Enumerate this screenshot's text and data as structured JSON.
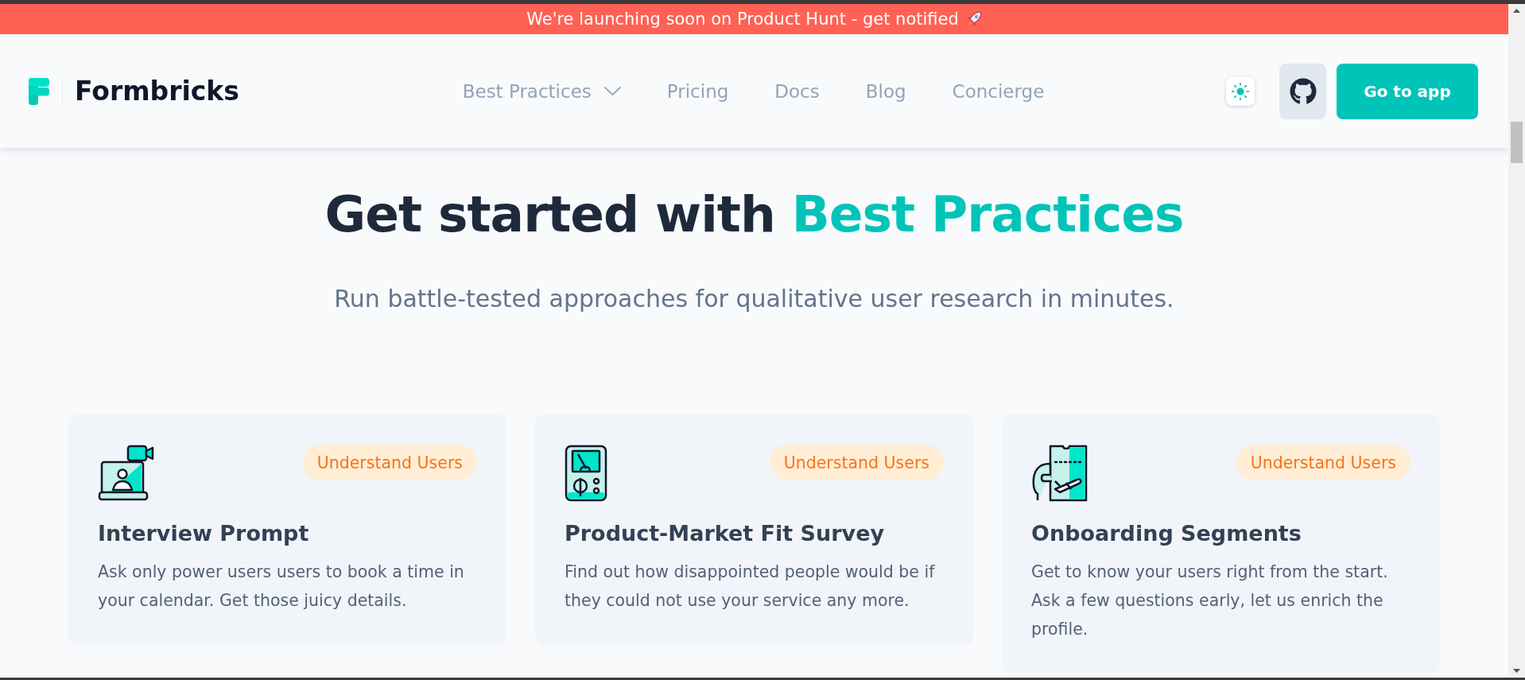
{
  "banner": {
    "text": "We're launching soon on Product Hunt - get notified"
  },
  "header": {
    "logo": "Formbricks",
    "nav": [
      {
        "label": "Best Practices",
        "dropdown": true
      },
      {
        "label": "Pricing",
        "dropdown": false
      },
      {
        "label": "Docs",
        "dropdown": false
      },
      {
        "label": "Blog",
        "dropdown": false
      },
      {
        "label": "Concierge",
        "dropdown": false
      }
    ],
    "cta": "Go to app"
  },
  "hero": {
    "title": "Get started with **Best Practices**",
    "subtitle": "Run battle-tested approaches for qualitative user research in minutes."
  },
  "cards": [
    {
      "tag": "Understand Users",
      "title": "Interview Prompt",
      "description": "Ask only power users users to book a time in your calendar. Get those juicy details."
    },
    {
      "tag": "Understand Users",
      "title": "Product-Market Fit Survey",
      "description": "Find out how disappointed people would be if they could not use your service any more."
    },
    {
      "tag": "Understand Users",
      "title": "Onboarding Segments",
      "description": "Get to know your users right from the start. Ask a few questions early, let us enrich the profile."
    }
  ]
}
